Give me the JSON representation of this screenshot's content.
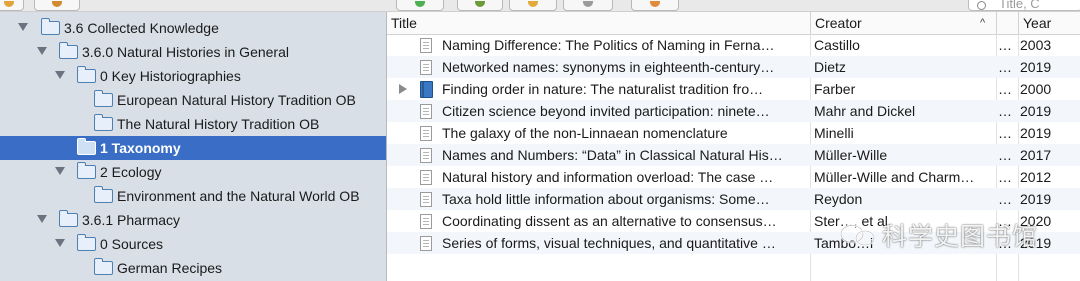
{
  "toolbar": {
    "buttons": [
      "new-collection-icon",
      "sync-icon",
      "new-item-icon",
      "add-note-icon",
      "attach-icon",
      "locate-icon"
    ],
    "search_placeholder": "Title, C"
  },
  "sidebar": {
    "items": [
      {
        "label": "3.6 Collected Knowledge",
        "icon": "folder-icon",
        "expanded": true,
        "selected": false
      },
      {
        "label": "3.6.0 Natural Histories in General",
        "icon": "folder-icon",
        "expanded": true,
        "selected": false
      },
      {
        "label": "0 Key Historiographies",
        "icon": "folder-icon",
        "expanded": true,
        "selected": false
      },
      {
        "label": "European Natural History Tradition OB",
        "icon": "folder-icon",
        "expanded": false,
        "selected": false
      },
      {
        "label": "The Natural History Tradition OB",
        "icon": "folder-icon",
        "expanded": false,
        "selected": false
      },
      {
        "label": "1 Taxonomy",
        "icon": "folder-icon",
        "expanded": false,
        "selected": true
      },
      {
        "label": "2 Ecology",
        "icon": "folder-icon",
        "expanded": true,
        "selected": false
      },
      {
        "label": "Environment and the Natural World OB",
        "icon": "folder-icon",
        "expanded": false,
        "selected": false
      },
      {
        "label": "3.6.1 Pharmacy",
        "icon": "folder-icon",
        "expanded": true,
        "selected": false
      },
      {
        "label": "0 Sources",
        "icon": "folder-icon",
        "expanded": true,
        "selected": false
      },
      {
        "label": "German Recipes",
        "icon": "folder-icon",
        "expanded": false,
        "selected": false
      }
    ]
  },
  "table": {
    "columns": {
      "title": "Title",
      "creator": "Creator",
      "sort_indicator": "^",
      "year": "Year"
    },
    "rows": [
      {
        "title": "Naming Difference: The Politics of Naming in Ferna…",
        "creator": "Castillo",
        "more": "…",
        "year": "2003",
        "icon": "document-icon"
      },
      {
        "title": "Networked names: synonyms in eighteenth-century…",
        "creator": "Dietz",
        "more": "…",
        "year": "2019",
        "icon": "document-icon"
      },
      {
        "title": "Finding order in nature: The naturalist tradition fro…",
        "creator": "Farber",
        "more": "…",
        "year": "2000",
        "icon": "book-icon"
      },
      {
        "title": "Citizen science beyond invited participation: ninete…",
        "creator": "Mahr and Dickel",
        "more": "…",
        "year": "2019",
        "icon": "document-icon"
      },
      {
        "title": "The galaxy of the non-Linnaean nomenclature",
        "creator": "Minelli",
        "more": "…",
        "year": "2019",
        "icon": "document-icon"
      },
      {
        "title": "Names and Numbers: “Data” in Classical Natural His…",
        "creator": "Müller-Wille",
        "more": "…",
        "year": "2017",
        "icon": "document-icon"
      },
      {
        "title": "Natural history and information overload: The case …",
        "creator": "Müller-Wille and Charm…",
        "more": "…",
        "year": "2012",
        "icon": "document-icon"
      },
      {
        "title": "Taxa hold little information about organisms: Some…",
        "creator": "Reydon",
        "more": "…",
        "year": "2019",
        "icon": "document-icon"
      },
      {
        "title": "Coordinating dissent as an alternative to consensus…",
        "creator": "Ster…, et al.",
        "more": "…",
        "year": "2020",
        "icon": "document-icon"
      },
      {
        "title": "Series of forms, visual techniques, and quantitative …",
        "creator": "Tambo…i",
        "more": "…",
        "year": "2019",
        "icon": "document-icon"
      }
    ]
  },
  "watermark": {
    "text": "科学史图书馆",
    "icon": "wechat-icon"
  },
  "colors": {
    "selection": "#3a6dc5",
    "sidebar_bg": "#d9dfe6",
    "alt_row": "#f3f6fa"
  }
}
